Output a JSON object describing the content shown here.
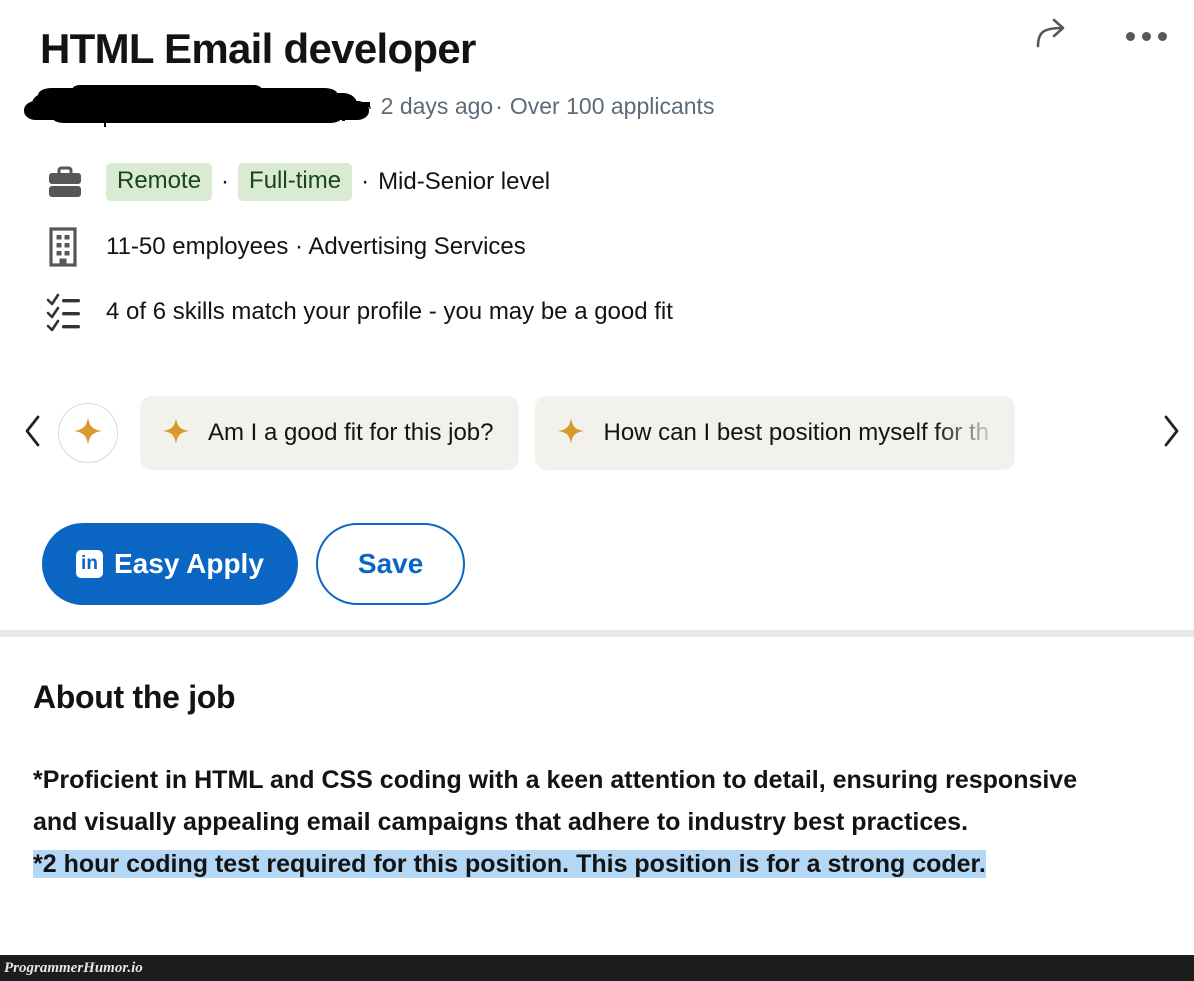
{
  "header": {
    "job_title": "HTML Email developer",
    "company_name_redacted": true,
    "separator": "·",
    "posted_ago": "2 days ago",
    "applicants": "Over 100 applicants",
    "share_icon": "share-arrow-icon",
    "more_icon": "more-options-icon"
  },
  "details": [
    {
      "icon": "briefcase-icon",
      "pills": [
        "Remote",
        "Full-time"
      ],
      "trailing": "Mid-Senior level",
      "separator": "·"
    },
    {
      "icon": "building-icon",
      "text": "11-50 employees · Advertising Services"
    },
    {
      "icon": "checklist-icon",
      "text": "4 of 6 skills match your profile - you may be a good fit"
    }
  ],
  "carousel": {
    "prev_icon": "chevron-left-icon",
    "next_icon": "chevron-right-icon",
    "sparkle_icon": "sparkle-icon",
    "chips": [
      {
        "icon": "sparkle-icon",
        "label": "Am I a good fit for this job?",
        "truncated": false
      },
      {
        "icon": "sparkle-icon",
        "label": "How can I best position myself for th",
        "truncated": true
      }
    ]
  },
  "actions": {
    "apply_label": "Easy Apply",
    "apply_logo": "in",
    "save_label": "Save"
  },
  "about": {
    "heading": "About the job",
    "paragraph": "*Proficient in HTML and CSS coding with a keen attention to detail, ensuring responsive and visually appealing email campaigns that adhere to industry best practices.",
    "highlighted_line": "*2 hour coding test required for this position. This position is for a strong coder."
  },
  "watermark": {
    "text": "ProgrammerHumor.io"
  },
  "colors": {
    "linkedin_blue": "#0a66c2",
    "pill_green_bg": "#d9ebd3",
    "pill_green_text": "#19441f",
    "chip_bg": "#f3f1ec",
    "sparkle_gold": "#d79b2b",
    "muted_text": "#5c6b77",
    "highlight_blue": "#b3d7f5",
    "divider_gray": "#e8e8e8",
    "watermark_bg": "#1c1c1c"
  }
}
